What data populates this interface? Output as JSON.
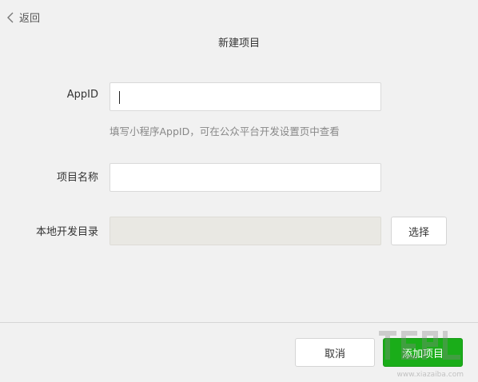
{
  "header": {
    "back_label": "返回",
    "title": "新建项目"
  },
  "form": {
    "appid_label": "AppID",
    "appid_value": "",
    "appid_hint": "填写小程序AppID，可在公众平台开发设置页中查看",
    "name_label": "项目名称",
    "name_value": "",
    "dir_label": "本地开发目录",
    "dir_value": "",
    "choose_label": "选择"
  },
  "footer": {
    "cancel_label": "取消",
    "add_label": "添加项目"
  },
  "watermark": {
    "text": "www.xiazaiba.com"
  },
  "colors": {
    "primary": "#1aad19",
    "background": "#f1f1f1",
    "disabled_field": "#e9e8e3"
  }
}
